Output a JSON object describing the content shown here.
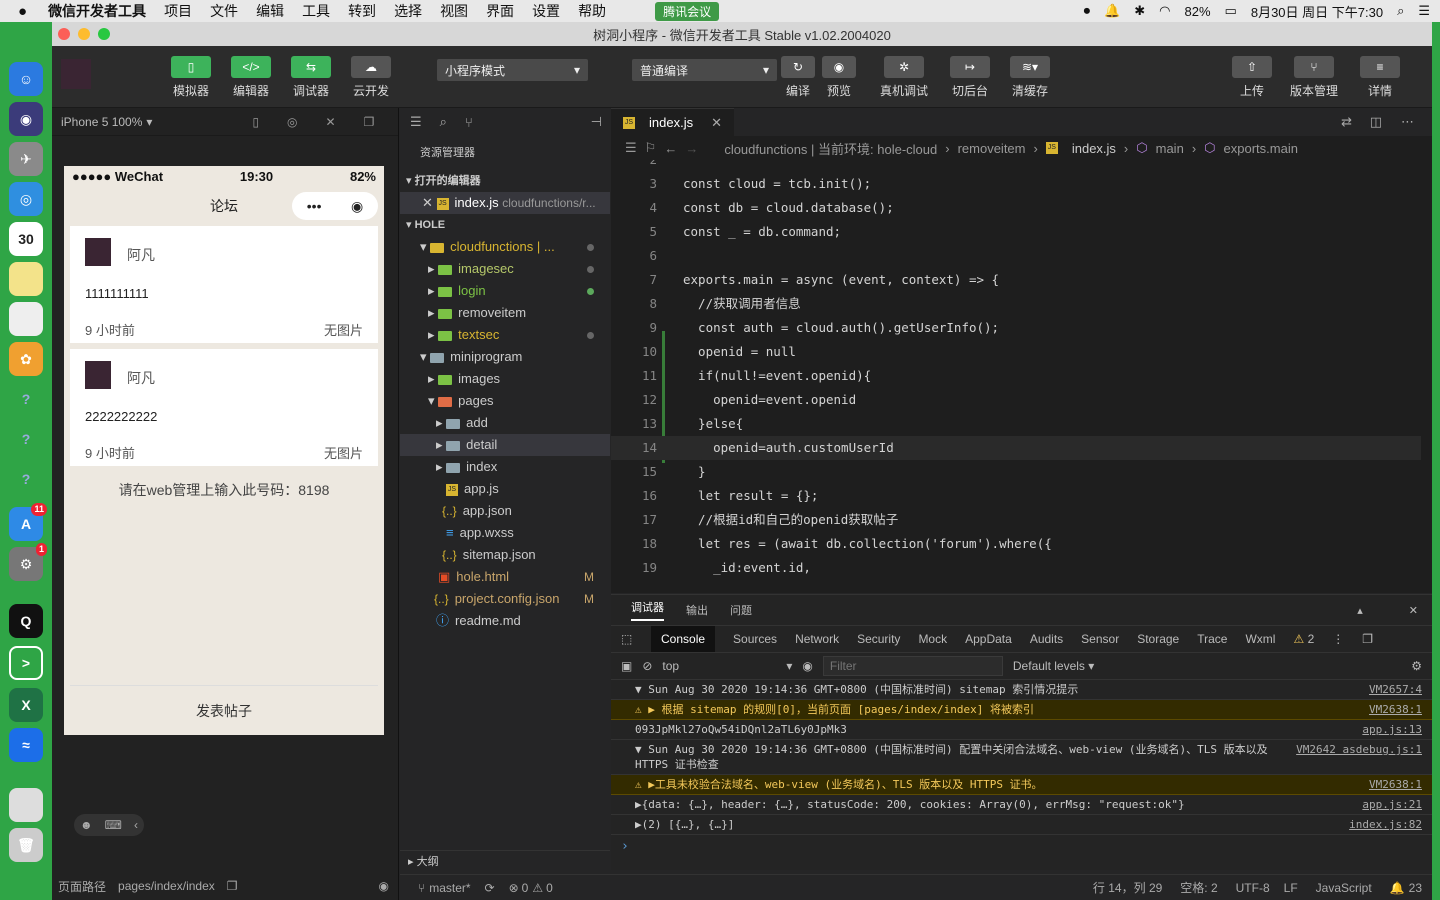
{
  "menubar": {
    "app": "微信开发者工具",
    "items": [
      "项目",
      "文件",
      "编辑",
      "工具",
      "转到",
      "选择",
      "视图",
      "界面",
      "设置",
      "帮助"
    ],
    "meeting": "腾讯会议",
    "battery": "82%",
    "datetime": "8月30日 周日 下午7:30"
  },
  "window": {
    "title": "树洞小程序 - 微信开发者工具 Stable v1.02.2004020"
  },
  "toolbar": {
    "simulator": "模拟器",
    "editor": "编辑器",
    "debugger": "调试器",
    "cloud": "云开发",
    "mode": "小程序模式",
    "compile_mode": "普通编译",
    "compile": "编译",
    "preview": "预览",
    "real_debug": "真机调试",
    "background": "切后台",
    "clear_cache": "清缓存",
    "upload": "上传",
    "version": "版本管理",
    "details": "详情"
  },
  "simulator": {
    "device": "iPhone 5 100%",
    "status": {
      "carrier": "●●●●● WeChat",
      "time": "19:30",
      "battery": "82%"
    },
    "nav_title": "论坛",
    "posts": [
      {
        "name": "阿凡",
        "content": "1111111111",
        "time": "9 小时前",
        "image": "无图片"
      },
      {
        "name": "阿凡",
        "content": "2222222222",
        "time": "9 小时前",
        "image": "无图片"
      }
    ],
    "code_hint": "请在web管理上输入此号码：8198",
    "publish": "发表帖子",
    "path_label": "页面路径",
    "path": "pages/index/index"
  },
  "explorer": {
    "title": "资源管理器",
    "open_editors": "打开的编辑器",
    "open_file": "index.js",
    "open_file_path": "cloudfunctions/r...",
    "project": "HOLE",
    "tree": [
      {
        "label": "cloudfunctions | ..."
      },
      {
        "label": "imagesec"
      },
      {
        "label": "login"
      },
      {
        "label": "removeitem"
      },
      {
        "label": "textsec"
      },
      {
        "label": "miniprogram"
      },
      {
        "label": "images"
      },
      {
        "label": "pages"
      },
      {
        "label": "add"
      },
      {
        "label": "detail"
      },
      {
        "label": "index"
      },
      {
        "label": "app.js"
      },
      {
        "label": "app.json"
      },
      {
        "label": "app.wxss"
      },
      {
        "label": "sitemap.json"
      },
      {
        "label": "hole.html"
      },
      {
        "label": "project.config.json"
      },
      {
        "label": "readme.md"
      }
    ],
    "outline": "大纲",
    "m_flag": "M"
  },
  "editor": {
    "tab": "index.js",
    "breadcrumb": [
      "cloudfunctions | 当前环境: hole-cloud",
      "removeitem",
      "index.js",
      "main",
      "exports.main"
    ],
    "lines": [
      {
        "n": "2",
        "t": ""
      },
      {
        "n": "3",
        "t": "const cloud = tcb.init();"
      },
      {
        "n": "4",
        "t": "const db = cloud.database();"
      },
      {
        "n": "5",
        "t": "const _ = db.command;"
      },
      {
        "n": "6",
        "t": ""
      },
      {
        "n": "7",
        "t": "exports.main = async (event, context) => {"
      },
      {
        "n": "8",
        "t": "  //获取调用者信息"
      },
      {
        "n": "9",
        "t": "  const auth = cloud.auth().getUserInfo();"
      },
      {
        "n": "10",
        "t": "  openid = null"
      },
      {
        "n": "11",
        "t": "  if(null!=event.openid){"
      },
      {
        "n": "12",
        "t": "    openid=event.openid"
      },
      {
        "n": "13",
        "t": "  }else{"
      },
      {
        "n": "14",
        "t": "    openid=auth.customUserId"
      },
      {
        "n": "15",
        "t": "  }"
      },
      {
        "n": "16",
        "t": "  let result = {};"
      },
      {
        "n": "17",
        "t": "  //根据id和自己的openid获取帖子"
      },
      {
        "n": "18",
        "t": "  let res = (await db.collection('forum').where({"
      },
      {
        "n": "19",
        "t": "    _id:event.id,"
      }
    ]
  },
  "console": {
    "tabs": [
      "调试器",
      "输出",
      "问题"
    ],
    "devtabs": [
      "Console",
      "Sources",
      "Network",
      "Security",
      "Mock",
      "AppData",
      "Audits",
      "Sensor",
      "Storage",
      "Trace",
      "Wxml"
    ],
    "warn_count": "2",
    "context": "top",
    "filter_placeholder": "Filter",
    "levels": "Default levels",
    "logs": [
      {
        "text": "▼ Sun Aug 30 2020 19:14:36 GMT+0800 (中国标准时间) sitemap 索引情况提示",
        "src": "VM2657:4",
        "type": "group"
      },
      {
        "text": "⚠ ▶ 根据 sitemap 的规则[0]，当前页面 [pages/index/index] 将被索引",
        "src": "VM2638:1",
        "type": "warn"
      },
      {
        "text": "093JpMkl27oQw54iDQnl2aTL6y0JpMk3",
        "src": "app.js:13",
        "type": "log"
      },
      {
        "text": "▼ Sun Aug 30 2020 19:14:36 GMT+0800 (中国标准时间) 配置中关闭合法域名、web-view (业务域名)、TLS 版本以及 HTTPS 证书检查",
        "src": "VM2642 asdebug.js:1",
        "type": "group"
      },
      {
        "text": "⚠ ▶工具未校验合法域名、web-view (业务域名)、TLS 版本以及 HTTPS 证书。",
        "src": "VM2638:1",
        "type": "warn"
      },
      {
        "text": "▶{data: {…}, header: {…}, statusCode: 200, cookies: Array(0), errMsg: \"request:ok\"}",
        "src": "app.js:21",
        "type": "log"
      },
      {
        "text": "▶(2) [{…}, {…}]",
        "src": "index.js:82",
        "type": "log"
      }
    ]
  },
  "statusbar": {
    "branch": "master*",
    "errors": "0",
    "warnings": "0",
    "position": "行 14，列 29",
    "spaces": "空格: 2",
    "encoding": "UTF-8",
    "eol": "LF",
    "language": "JavaScript",
    "notifications": "23"
  }
}
